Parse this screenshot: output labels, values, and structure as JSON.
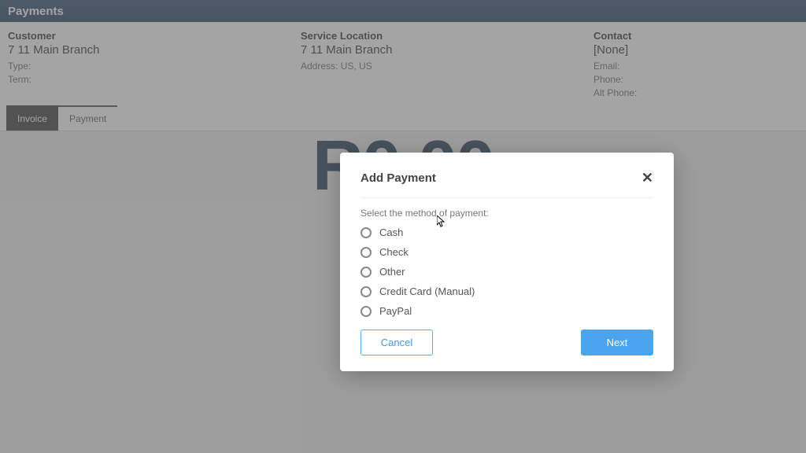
{
  "topbar": {
    "title": "Payments"
  },
  "customer": {
    "heading": "Customer",
    "name": "7 11 Main Branch",
    "type_label": "Type:",
    "type_value": "",
    "term_label": "Term:",
    "term_value": ""
  },
  "service": {
    "heading": "Service Location",
    "name": "7 11 Main Branch",
    "address_label": "Address: US, US"
  },
  "contact": {
    "heading": "Contact",
    "name": "[None]",
    "email_label": "Email:",
    "phone_label": "Phone:",
    "alt_phone_label": "Alt Phone:"
  },
  "tabs": {
    "invoice": "Invoice",
    "payment": "Payment"
  },
  "big_amount": "R0.00",
  "modal": {
    "title": "Add Payment",
    "subtitle": "Select the method of payment:",
    "options": {
      "cash": "Cash",
      "check": "Check",
      "other": "Other",
      "cc_manual": "Credit Card (Manual)",
      "paypal": "PayPal"
    },
    "cancel": "Cancel",
    "next": "Next"
  }
}
